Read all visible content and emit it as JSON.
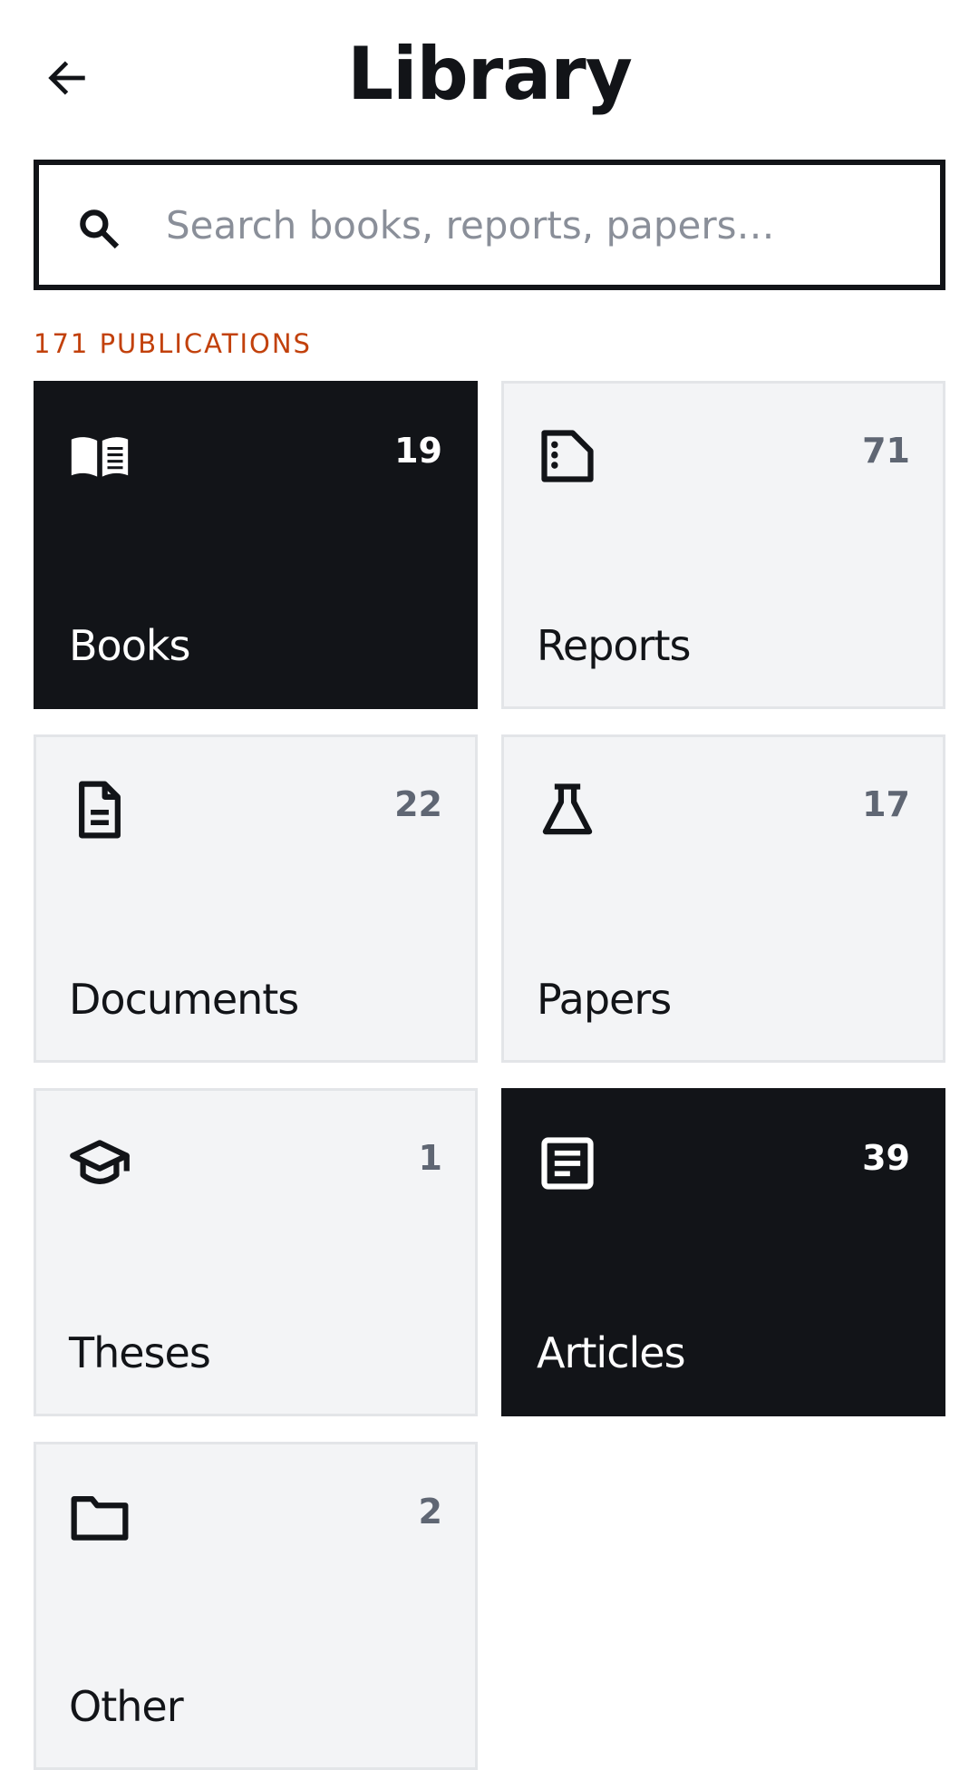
{
  "header": {
    "back_icon": "arrow-left-icon",
    "title": "Library"
  },
  "search": {
    "icon": "search-icon",
    "placeholder": "Search books, reports, papers…",
    "value": ""
  },
  "summary": {
    "count_label": "171 PUBLICATIONS"
  },
  "colors": {
    "accent": "#c2410c",
    "dark_card": "#121418",
    "light_card": "#f3f4f6",
    "count_muted": "#5f6673"
  },
  "categories": [
    {
      "label": "Books",
      "count": "19",
      "icon": "open-book-icon",
      "selected": true
    },
    {
      "label": "Reports",
      "count": "71",
      "icon": "report-file-icon",
      "selected": false
    },
    {
      "label": "Documents",
      "count": "22",
      "icon": "document-icon",
      "selected": false
    },
    {
      "label": "Papers",
      "count": "17",
      "icon": "flask-icon",
      "selected": false
    },
    {
      "label": "Theses",
      "count": "1",
      "icon": "graduation-cap-icon",
      "selected": false
    },
    {
      "label": "Articles",
      "count": "39",
      "icon": "article-icon",
      "selected": true
    },
    {
      "label": "Other",
      "count": "2",
      "icon": "folder-icon",
      "selected": false
    }
  ]
}
